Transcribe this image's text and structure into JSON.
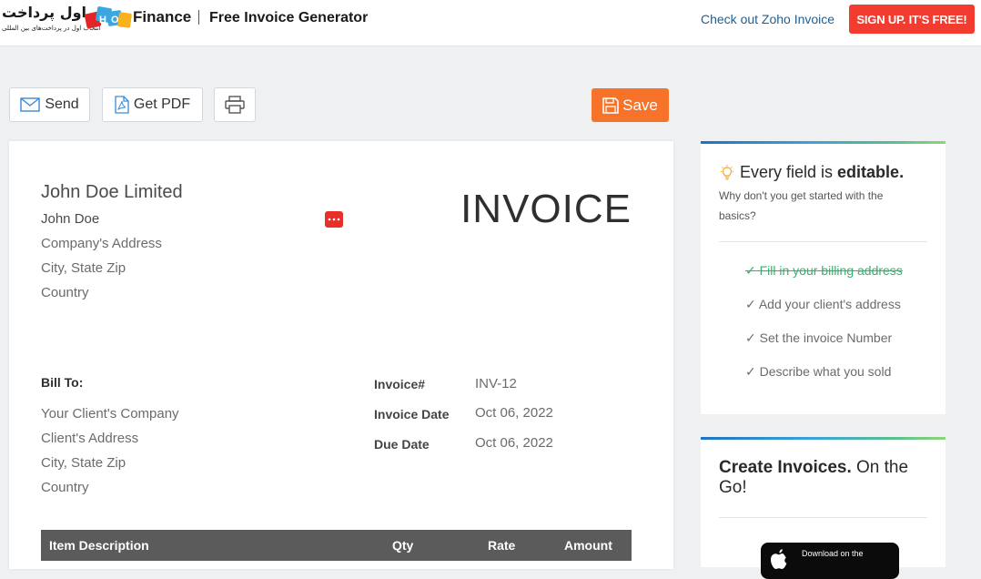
{
  "header": {
    "watermark_text": "اول پرداخت",
    "watermark_subtitle": "انتخاب اول در پرداخت‌های بین المللی",
    "brand_name": "Finance",
    "page_title": "Free Invoice Generator",
    "check_link": "Check out Zoho Invoice",
    "signup_label": "SIGN UP. IT'S FREE!",
    "signup_color": "#f23c2f",
    "link_color": "#1e5f93"
  },
  "toolbar": {
    "send_label": "Send",
    "pdf_label": "Get PDF",
    "save_label": "Save",
    "save_color": "#f7732a"
  },
  "invoice": {
    "title": "INVOICE",
    "from": {
      "company": "John Doe Limited",
      "name": "John Doe",
      "address": "Company's Address",
      "city": "City, State Zip",
      "country": "Country"
    },
    "bill_to_label": "Bill To:",
    "to": {
      "company": "Your Client's Company",
      "address": "Client's Address",
      "city": "City, State Zip",
      "country": "Country"
    },
    "meta": [
      {
        "label": "Invoice#",
        "value": "INV-12"
      },
      {
        "label": "Invoice Date",
        "value": "Oct 06, 2022"
      },
      {
        "label": "Due Date",
        "value": "Oct 06, 2022"
      }
    ],
    "columns": {
      "description": "Item Description",
      "qty": "Qty",
      "rate": "Rate",
      "amount": "Amount"
    }
  },
  "tips": {
    "heading_prefix": "Every field is",
    "heading_bold": "editable.",
    "subtitle": "Why don't you get started with the basics?",
    "items": [
      {
        "label": "✓ Fill in your billing address",
        "done": true
      },
      {
        "label": "✓ Add your client's address",
        "done": false
      },
      {
        "label": "✓ Set the invoice Number",
        "done": false
      },
      {
        "label": "✓ Describe what you sold",
        "done": false
      }
    ],
    "done_color": "#32b36b"
  },
  "promo": {
    "heading_bold": "Create Invoices.",
    "heading_rest": "On the Go!",
    "store_small": "Download on the"
  },
  "icons": {
    "send": "envelope-icon",
    "pdf": "pdf-file-icon",
    "print": "printer-icon",
    "save": "floppy-disk-icon",
    "tip": "lightbulb-icon",
    "more": "more-dots-icon",
    "store": "apple-icon"
  }
}
